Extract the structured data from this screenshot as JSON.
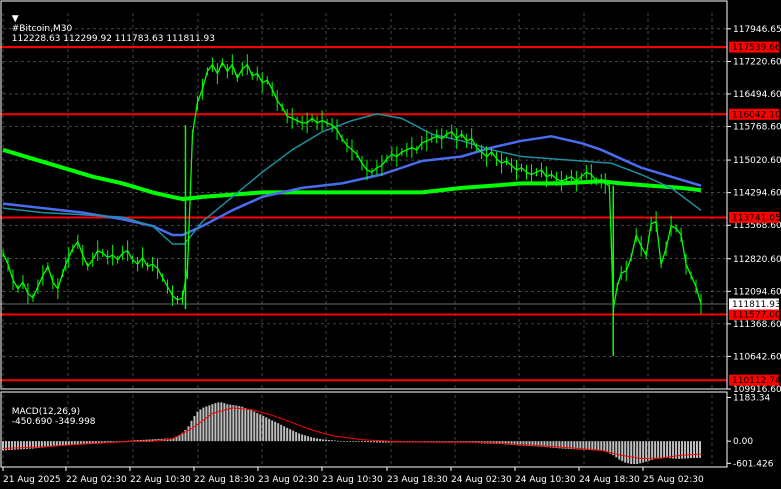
{
  "header": {
    "symbol_label": "#Bitcoin,M30",
    "ohlc": "112228.63 112299.92 111783.63 111811.93"
  },
  "macd_header": {
    "label": "MACD(12,26,9)",
    "values": "-450.690 -349.998"
  },
  "colors": {
    "background": "#000000",
    "grid": "#c0c0c0",
    "candles": "#00ff00",
    "level_line": "#ff0000",
    "ma_fast": "#1f8fa0",
    "ma_mid": "#4a6cf0",
    "ma_slow": "#00ff00",
    "macd_hist": "#bfbfbf",
    "macd_signal": "#ff0000",
    "axis_text": "#ffffff"
  },
  "chart_data": {
    "type": "line",
    "title": "#Bitcoin,M30",
    "price_axis_ticks": [
      "117946.65",
      "117220.60",
      "116494.60",
      "115768.60",
      "115020.60",
      "114294.60",
      "113568.60",
      "112820.60",
      "112094.60",
      "111368.60",
      "110642.60",
      "109916.60"
    ],
    "time_axis_ticks": [
      "21 Aug 2025",
      "22 Aug 02:30",
      "22 Aug 10:30",
      "22 Aug 18:30",
      "23 Aug 02:30",
      "23 Aug 10:30",
      "23 Aug 18:30",
      "24 Aug 02:30",
      "24 Aug 10:30",
      "24 Aug 18:30",
      "25 Aug 02:30"
    ],
    "ylim": [
      109916.6,
      118300
    ],
    "horizontal_levels": [
      {
        "value": 117539.66,
        "label": "117539.66"
      },
      {
        "value": 116042.1,
        "label": "116042.10"
      },
      {
        "value": 113741.05,
        "label": "113741.05"
      },
      {
        "value": 111577.0,
        "label": "111577.00"
      },
      {
        "value": 110112.74,
        "label": "110112.74"
      }
    ],
    "current_price": {
      "value": 111811.93,
      "label": "111811.93"
    },
    "price_series": {
      "x": [
        0,
        5,
        10,
        15,
        20,
        25,
        30,
        35,
        40,
        45,
        50,
        55,
        60,
        63,
        66,
        70,
        75,
        80,
        85,
        90,
        95,
        100,
        105,
        110,
        115,
        120,
        125,
        130,
        135,
        140,
        145,
        150,
        155,
        160,
        165,
        170,
        175,
        180,
        185,
        190,
        195,
        200,
        205,
        210,
        215,
        220,
        225,
        230,
        235,
        240,
        245,
        250,
        255,
        260,
        265,
        270,
        275,
        280,
        285,
        290,
        295,
        300,
        305,
        310,
        315,
        320,
        325,
        330,
        335,
        340,
        345,
        350,
        355,
        360,
        365,
        370,
        375,
        380,
        385,
        390,
        395,
        400,
        405,
        410,
        415,
        420,
        425,
        430,
        435,
        440,
        445,
        450,
        455,
        460,
        465,
        470,
        475,
        480,
        485,
        490,
        495,
        500,
        505,
        510,
        515,
        520,
        525,
        530,
        535,
        540,
        545,
        550,
        555,
        560,
        565,
        570,
        575,
        580,
        585,
        590,
        595,
        600,
        604,
        608,
        610,
        612,
        616,
        620,
        625,
        630,
        635,
        640,
        645,
        650,
        655,
        660,
        665,
        670,
        675,
        680,
        685,
        690,
        695,
        700
      ],
      "y": [
        112950,
        112700,
        112350,
        112150,
        112300,
        112050,
        111950,
        112200,
        112450,
        112650,
        112300,
        112150,
        112500,
        112700,
        112850,
        113050,
        113200,
        112900,
        112650,
        112800,
        113000,
        112950,
        112850,
        112900,
        112800,
        112950,
        113000,
        112800,
        112700,
        112850,
        112650,
        112700,
        112600,
        112400,
        112200,
        112000,
        111900,
        111950,
        112600,
        115600,
        116300,
        116600,
        117000,
        117150,
        116950,
        117200,
        117000,
        117150,
        116850,
        117050,
        117150,
        116900,
        116950,
        116750,
        116800,
        116600,
        116350,
        116200,
        116000,
        115950,
        115900,
        115850,
        115850,
        115950,
        115850,
        115900,
        115850,
        115800,
        115700,
        115500,
        115350,
        115250,
        115150,
        114950,
        114800,
        114750,
        114850,
        114900,
        115050,
        115150,
        115100,
        115200,
        115250,
        115300,
        115250,
        115400,
        115450,
        115500,
        115550,
        115500,
        115600,
        115650,
        115500,
        115600,
        115450,
        115500,
        115300,
        115200,
        115100,
        115200,
        115050,
        114950,
        115000,
        114900,
        114800,
        114850,
        114750,
        114700,
        114750,
        114800,
        114650,
        114700,
        114600,
        114550,
        114600,
        114650,
        114550,
        114650,
        114750,
        114700,
        114550,
        114550,
        114500,
        114450,
        113200,
        111700,
        112200,
        112500,
        112550,
        112850,
        113350,
        113100,
        112900,
        113600,
        113650,
        112700,
        113050,
        113550,
        113500,
        113350,
        112700,
        112450,
        112200,
        111811.93
      ]
    },
    "ma_fast": {
      "x": [
        0,
        40,
        80,
        120,
        150,
        170,
        182,
        200,
        230,
        260,
        290,
        320,
        350,
        375,
        400,
        430,
        460,
        490,
        520,
        550,
        580,
        610,
        640,
        670,
        700
      ],
      "y": [
        113950,
        113850,
        113800,
        113750,
        113550,
        113150,
        113150,
        113650,
        114200,
        114750,
        115250,
        115650,
        115900,
        116050,
        115950,
        115600,
        115450,
        115250,
        115100,
        115050,
        115000,
        114950,
        114700,
        114400,
        113900
      ]
    },
    "ma_mid": {
      "x": [
        0,
        40,
        80,
        120,
        150,
        170,
        180,
        200,
        230,
        260,
        300,
        340,
        380,
        420,
        460,
        490,
        520,
        550,
        580,
        600,
        620,
        640,
        670,
        700
      ],
      "y": [
        114050,
        113950,
        113850,
        113700,
        113550,
        113350,
        113350,
        113550,
        113900,
        114200,
        114400,
        114500,
        114700,
        115000,
        115100,
        115300,
        115450,
        115550,
        115400,
        115250,
        115050,
        114850,
        114650,
        114450
      ]
    },
    "ma_slow": {
      "x": [
        0,
        30,
        60,
        90,
        120,
        150,
        170,
        180,
        200,
        230,
        260,
        300,
        340,
        380,
        420,
        460,
        490,
        520,
        560,
        600,
        620,
        650,
        680,
        700
      ],
      "y": [
        115250,
        115050,
        114850,
        114650,
        114500,
        114300,
        114200,
        114150,
        114200,
        114250,
        114300,
        114300,
        114300,
        114300,
        114300,
        114400,
        114450,
        114500,
        114500,
        114550,
        114500,
        114450,
        114400,
        114350
      ]
    },
    "macd": {
      "label": "MACD(12,26,9)",
      "main_value": -450.69,
      "signal_value": -349.998,
      "axis_ticks": [
        "1183.34",
        "0.00",
        "-601.426"
      ],
      "ylim": [
        -700,
        1250
      ],
      "hist_x": [
        0,
        30,
        60,
        90,
        110,
        130,
        150,
        170,
        178,
        185,
        190,
        195,
        200,
        205,
        210,
        215,
        220,
        225,
        230,
        235,
        240,
        245,
        250,
        255,
        260,
        265,
        270,
        275,
        280,
        285,
        290,
        295,
        300,
        310,
        320,
        340,
        360,
        380,
        400,
        420,
        440,
        460,
        480,
        500,
        520,
        540,
        560,
        580,
        600,
        606,
        612,
        618,
        624,
        630,
        636,
        642,
        648,
        654,
        660,
        666,
        672,
        678,
        684,
        690,
        696,
        700
      ],
      "hist_y": [
        -250,
        -200,
        -120,
        -60,
        -20,
        20,
        50,
        80,
        180,
        350,
        600,
        800,
        900,
        950,
        1000,
        1050,
        1050,
        1000,
        980,
        960,
        930,
        880,
        830,
        760,
        700,
        630,
        560,
        500,
        430,
        360,
        300,
        230,
        180,
        100,
        50,
        0,
        -20,
        -40,
        -30,
        -10,
        0,
        -20,
        -60,
        -80,
        -120,
        -150,
        -200,
        -230,
        -260,
        -300,
        -380,
        -500,
        -580,
        -620,
        -620,
        -580,
        -530,
        -480,
        -460,
        -450,
        -470,
        -480,
        -470,
        -460,
        -455,
        -450.69
      ],
      "signal_x": [
        0,
        40,
        80,
        120,
        150,
        170,
        190,
        210,
        230,
        250,
        270,
        290,
        310,
        330,
        360,
        400,
        440,
        480,
        520,
        560,
        600,
        620,
        640,
        660,
        680,
        700
      ],
      "signal_y": [
        -200,
        -150,
        -80,
        -20,
        0,
        60,
        350,
        750,
        900,
        850,
        700,
        500,
        300,
        150,
        40,
        -20,
        -30,
        -30,
        -90,
        -160,
        -250,
        -380,
        -470,
        -460,
        -380,
        -349.998
      ]
    }
  }
}
